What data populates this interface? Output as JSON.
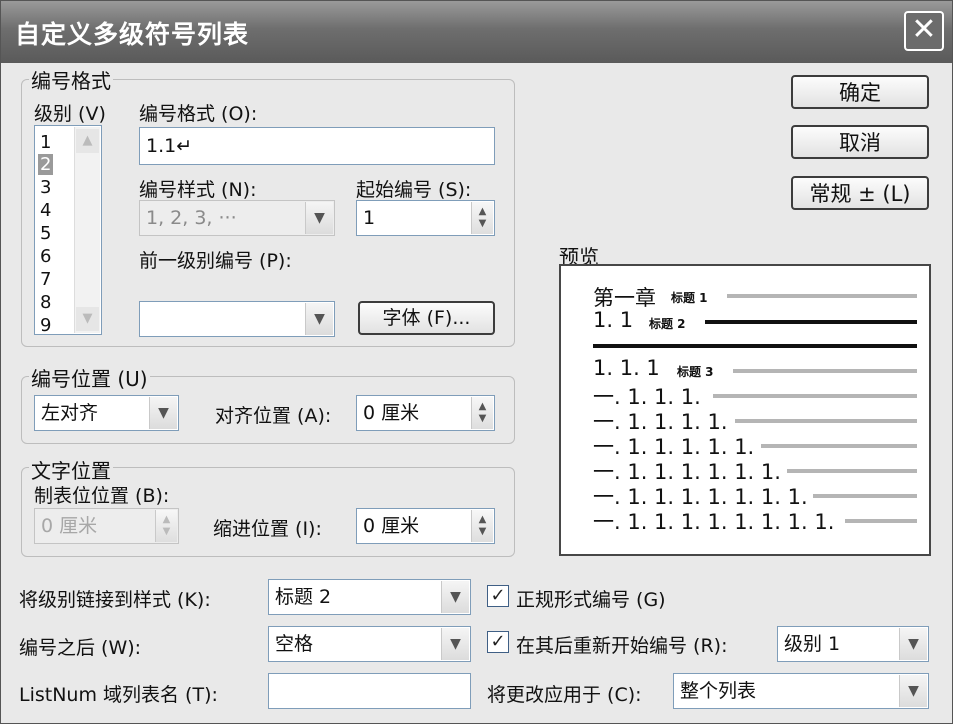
{
  "dialog": {
    "title": "自定义多级符号列表"
  },
  "buttons": {
    "ok": "确定",
    "cancel": "取消",
    "normal": "常规 ±  (L)"
  },
  "number_format": {
    "group_label": "编号格式",
    "level_label": "级别 (V)",
    "levels": [
      "1",
      "2",
      "3",
      "4",
      "5",
      "6",
      "7",
      "8",
      "9"
    ],
    "format_label": "编号格式 (O):",
    "format_value": "1.1↵",
    "style_label": "编号样式 (N):",
    "style_value": "1, 2, 3, ···",
    "start_label": "起始编号 (S):",
    "start_value": "1",
    "prev_level_label": "前一级别编号 (P):",
    "prev_level_value": "",
    "font_button": "字体 (F)..."
  },
  "number_position": {
    "group_label": "编号位置 (U)",
    "align_value": "左对齐",
    "align_at_label": "对齐位置 (A):",
    "align_at_value": "0 厘米"
  },
  "text_position": {
    "group_label": "文字位置",
    "tab_label": "制表位位置 (B):",
    "tab_value": "0 厘米",
    "indent_label": "缩进位置 (I):",
    "indent_value": "0 厘米"
  },
  "preview": {
    "label": "预览",
    "lines": [
      {
        "text": "第一章",
        "tag": "标题 1"
      },
      {
        "text": "1. 1",
        "tag": "标题 2"
      },
      {
        "text": "1. 1. 1",
        "tag": "标题 3"
      },
      {
        "text": "一. 1. 1. 1."
      },
      {
        "text": "一. 1. 1. 1. 1."
      },
      {
        "text": "一. 1. 1. 1. 1. 1."
      },
      {
        "text": "一. 1. 1. 1. 1. 1. 1."
      },
      {
        "text": "一. 1. 1. 1. 1. 1. 1. 1."
      },
      {
        "text": "一. 1. 1. 1. 1. 1. 1. 1. 1."
      }
    ]
  },
  "bottom": {
    "link_style_label": "将级别链接到样式 (K):",
    "link_style_value": "标题 2",
    "after_number_label": "编号之后 (W):",
    "after_number_value": "空格",
    "listnum_label": "ListNum 域列表名 (T):",
    "listnum_value": "",
    "legal_label": "正规形式编号 (G)",
    "restart_label": "在其后重新开始编号 (R):",
    "restart_value": "级别 1",
    "apply_label": "将更改应用于 (C):",
    "apply_value": "整个列表"
  },
  "icons": {
    "close": "close-icon",
    "dropdown": "chevron-down-icon",
    "spin": "spinner-arrows-icon",
    "check": "checkmark-icon"
  },
  "colors": {
    "titlebar": "#6e6e6e",
    "dialog_bg": "#e9e9e9",
    "field_border": "#7f9db9"
  }
}
